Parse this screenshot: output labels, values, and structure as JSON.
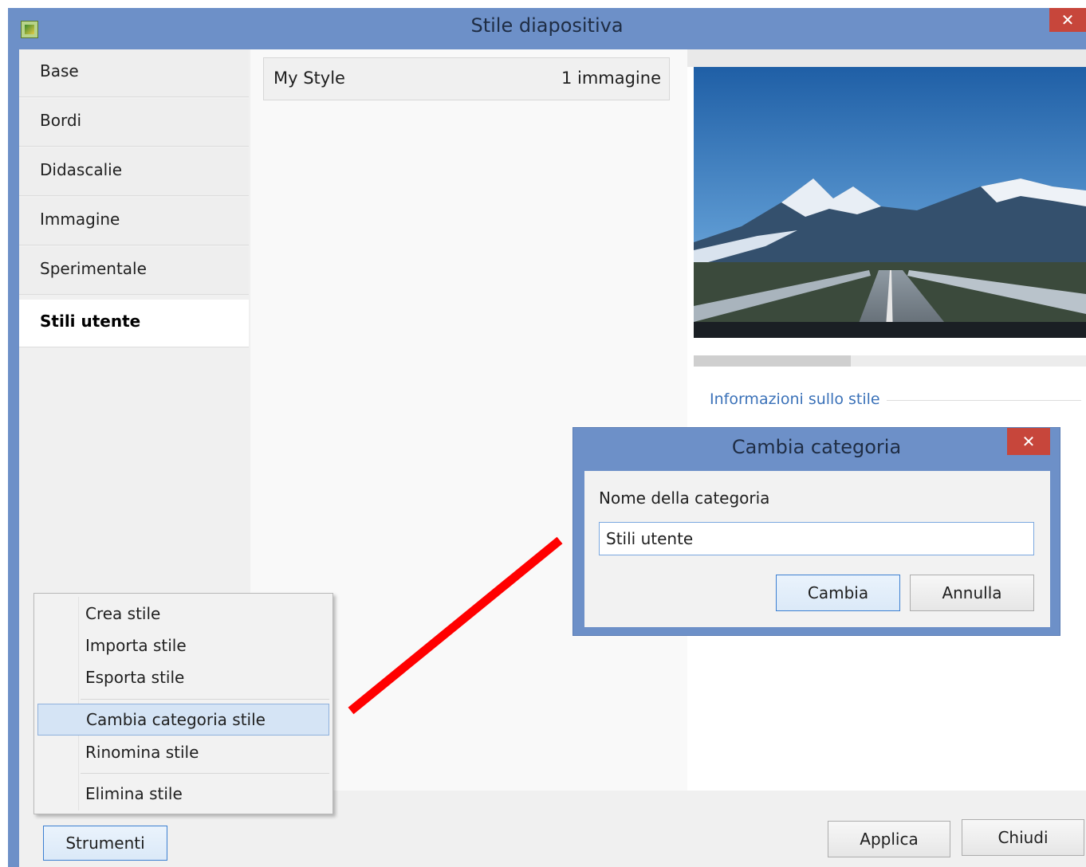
{
  "window": {
    "title": "Stile diapositiva",
    "close_glyph": "✕"
  },
  "nav": {
    "items": [
      {
        "label": "Base"
      },
      {
        "label": "Bordi"
      },
      {
        "label": "Didascalie"
      },
      {
        "label": "Immagine"
      },
      {
        "label": "Sperimentale"
      },
      {
        "label": "Stili utente",
        "active": true
      }
    ]
  },
  "styles_list": [
    {
      "name": "My Style",
      "count": "1 immagine"
    }
  ],
  "preview": {
    "progress_fraction": 0.4
  },
  "info": {
    "label": "Informazioni sullo stile"
  },
  "buttons": {
    "tools": "Strumenti",
    "apply": "Applica",
    "close": "Chiudi"
  },
  "context_menu": {
    "items": [
      "Crea stile",
      "Importa stile",
      "Esporta stile",
      "Cambia categoria stile",
      "Rinomina stile",
      "Elimina stile"
    ],
    "highlighted": "Cambia categoria stile"
  },
  "dialog": {
    "title": "Cambia categoria",
    "close_glyph": "✕",
    "field_label": "Nome della categoria",
    "field_value": "Stili utente",
    "confirm": "Cambia",
    "cancel": "Annulla"
  },
  "colors": {
    "accent_arrow": "#ff0000",
    "title_bar": "#6d90c8",
    "close_red": "#c7463b"
  }
}
